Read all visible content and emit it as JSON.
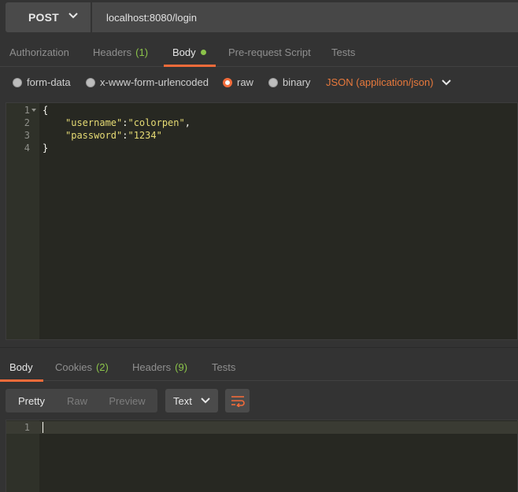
{
  "request": {
    "method": "POST",
    "url": "localhost:8080/login"
  },
  "request_tabs": [
    {
      "label": "Authorization",
      "count": ""
    },
    {
      "label": "Headers",
      "count": "(1)"
    },
    {
      "label": "Body",
      "count": ""
    },
    {
      "label": "Pre-request Script",
      "count": ""
    },
    {
      "label": "Tests",
      "count": ""
    }
  ],
  "active_request_tab": "Body",
  "body_types": [
    {
      "label": "form-data",
      "selected": false
    },
    {
      "label": "x-www-form-urlencoded",
      "selected": false
    },
    {
      "label": "raw",
      "selected": true
    },
    {
      "label": "binary",
      "selected": false
    }
  ],
  "content_type": "JSON (application/json)",
  "request_body": {
    "line_numbers": [
      "1",
      "2",
      "3",
      "4"
    ],
    "open_brace": "{",
    "close_brace": "}",
    "username_key": "\"username\"",
    "username_value": "\"colorpen\"",
    "password_key": "\"password\"",
    "password_value": "\"1234\""
  },
  "response_tabs": [
    {
      "label": "Body",
      "count": ""
    },
    {
      "label": "Cookies",
      "count": "(2)"
    },
    {
      "label": "Headers",
      "count": "(9)"
    },
    {
      "label": "Tests",
      "count": ""
    }
  ],
  "active_response_tab": "Body",
  "view_modes": [
    "Pretty",
    "Raw",
    "Preview"
  ],
  "active_view_mode": "Pretty",
  "response_format": "Text",
  "response_body": {
    "line_numbers": [
      "1"
    ]
  },
  "colors": {
    "accent": "#f26b3a",
    "count_green": "#8bc34a",
    "editor_bg": "#272822",
    "string": "#e6db74"
  },
  "icons": {
    "method_dropdown": "chevron-down-icon",
    "content_type_dropdown": "chevron-down-icon",
    "format_dropdown": "chevron-down-icon",
    "wrap": "wrap-lines-icon"
  }
}
